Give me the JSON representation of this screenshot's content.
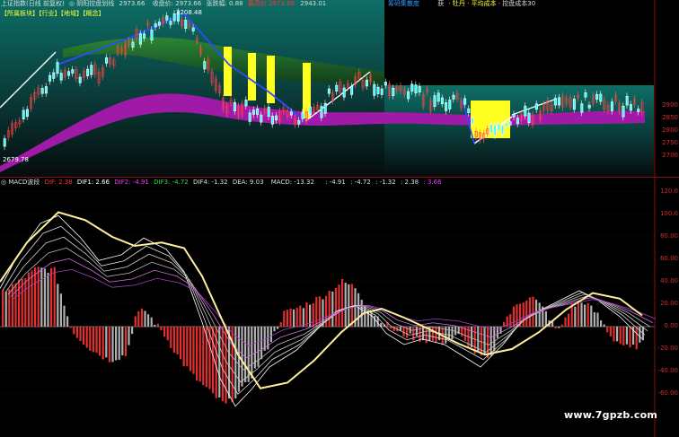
{
  "colors": {
    "background": "#000000",
    "axis_red": "#cc2222",
    "magenta_band": "#a01aa8",
    "green_band": "#2c6e2a",
    "teal_top": "#0f6b63",
    "yellow_bar": "#ffff22",
    "macd_pos": "#e23030",
    "macd_neg": "#a8a8a8",
    "dea_line": "#fff0a0"
  },
  "main_header": {
    "index_name": "上证指数(日线 前复权)",
    "indicator_name": "◎ 阴阳控盘划线",
    "indicator_value": "2973.66",
    "close_label": "收盘价: 2973.66",
    "change_label": "涨跌幅: 0.88",
    "max_label": "最高价",
    "max_value": "2973.66",
    "value2": "2943.01",
    "right_label_1": "筹码集散度",
    "right_label_2": "获",
    "right_label_3": "· 牡丹 · 平均成本",
    "right_label_4": "· 控盘成本30"
  },
  "main_tags": {
    "tag1": "【所属板块】",
    "tag2": "【行业】",
    "tag3": "【地域】",
    "tag4": "【概念】"
  },
  "main_annotations": {
    "high": "3208.48",
    "low": "2679.78"
  },
  "main_axis_labels": [
    "2900",
    "2850",
    "2800",
    "2750",
    "2700"
  ],
  "macd_header": {
    "name": "◎ MACD波段",
    "dif": "DIF: 2.38",
    "dif1": "DIF1: 2.66",
    "dif2": "DIF2: -4.91",
    "dif3": "DIF3: -4.72",
    "dif4": "DIF4: -1.32",
    "dea": "DEA: 9.03",
    "macd": "MACD: -13.32",
    "v1": ": -4.91",
    "v2": ": -4.72",
    "v3": ": -1.32",
    "v4": ": 2.38",
    "v5": ": 3.66"
  },
  "macd_axis_labels": [
    "120.0",
    "100.0",
    "80.00",
    "60.00",
    "40.00",
    "20.00",
    "0.00",
    "-20.00",
    "-40.00",
    "-60.00"
  ],
  "watermark": "www.7gpzb.com"
}
